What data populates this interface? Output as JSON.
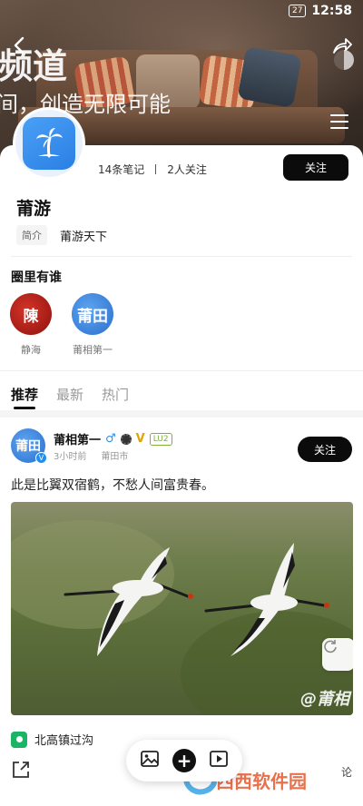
{
  "status_bar": {
    "battery": "27",
    "time": "12:58"
  },
  "banner": {
    "title_fragment": "频道",
    "slogan_fragment": "间，创造无限可能"
  },
  "profile": {
    "notes_count": "14条笔记",
    "followers": "2人关注",
    "follow_label": "关注",
    "name": "莆游",
    "intro_tag": "简介",
    "intro_text": "莆游天下"
  },
  "circle": {
    "title": "圈里有谁",
    "members": [
      {
        "name": "静海",
        "avatar_text": "陳"
      },
      {
        "name": "莆相第一",
        "avatar_text": "莆田"
      }
    ]
  },
  "tabs": [
    {
      "label": "推荐",
      "active": true
    },
    {
      "label": "最新",
      "active": false
    },
    {
      "label": "热门",
      "active": false
    }
  ],
  "post": {
    "author": "莆相第一",
    "avatar_text": "莆田",
    "verified_mark": "V",
    "vip_mark": "V",
    "level": "LU2",
    "time": "3小时前",
    "city": "莆田市",
    "follow_label": "关注",
    "text": "此是比翼双宿鹤，不愁人间富贵春。",
    "image_watermark": "@莆相",
    "location": "北高镇过沟",
    "comment_fragment": "论"
  },
  "overlay": {
    "site_watermark": "西西软件园"
  },
  "colors": {
    "accent": "#0b0b0b",
    "location_green": "#19b464",
    "link_blue": "#2d8ff0"
  }
}
